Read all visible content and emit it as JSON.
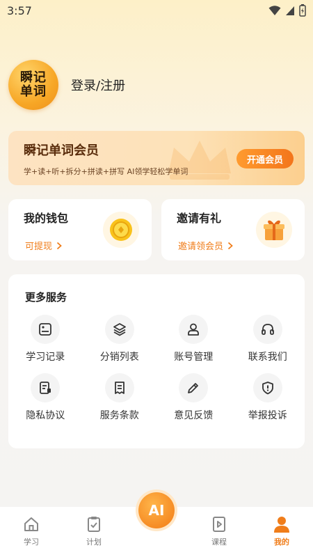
{
  "status_bar": {
    "time": "3:57"
  },
  "profile": {
    "logo_line1": "瞬记",
    "logo_line2": "单词",
    "login_label": "登录/注册"
  },
  "vip": {
    "title": "瞬记单词会员",
    "subtitle": "学+读+听+拆分+拼读+拼写 AI领学轻松学单词",
    "button": "开通会员"
  },
  "wallet": {
    "title": "我的钱包",
    "link": "可提现"
  },
  "invite": {
    "title": "邀请有礼",
    "link": "邀请领会员"
  },
  "services": {
    "title": "更多服务",
    "items": [
      {
        "label": "学习记录",
        "icon": "record-icon"
      },
      {
        "label": "分销列表",
        "icon": "layers-icon"
      },
      {
        "label": "账号管理",
        "icon": "user-icon"
      },
      {
        "label": "联系我们",
        "icon": "headphones-icon"
      },
      {
        "label": "隐私协议",
        "icon": "privacy-doc-icon"
      },
      {
        "label": "服务条款",
        "icon": "terms-doc-icon"
      },
      {
        "label": "意见反馈",
        "icon": "pencil-icon"
      },
      {
        "label": "举报投诉",
        "icon": "report-shield-icon"
      }
    ]
  },
  "tabbar": {
    "items": [
      {
        "label": "学习",
        "icon": "home-icon"
      },
      {
        "label": "计划",
        "icon": "clipboard-check-icon"
      },
      {
        "label": "AI",
        "icon": "ai-icon"
      },
      {
        "label": "课程",
        "icon": "play-doc-icon"
      },
      {
        "label": "我的",
        "icon": "profile-icon"
      }
    ],
    "active": "我的"
  },
  "colors": {
    "accent": "#f07d1a",
    "vip_text": "#5a2d0c"
  }
}
